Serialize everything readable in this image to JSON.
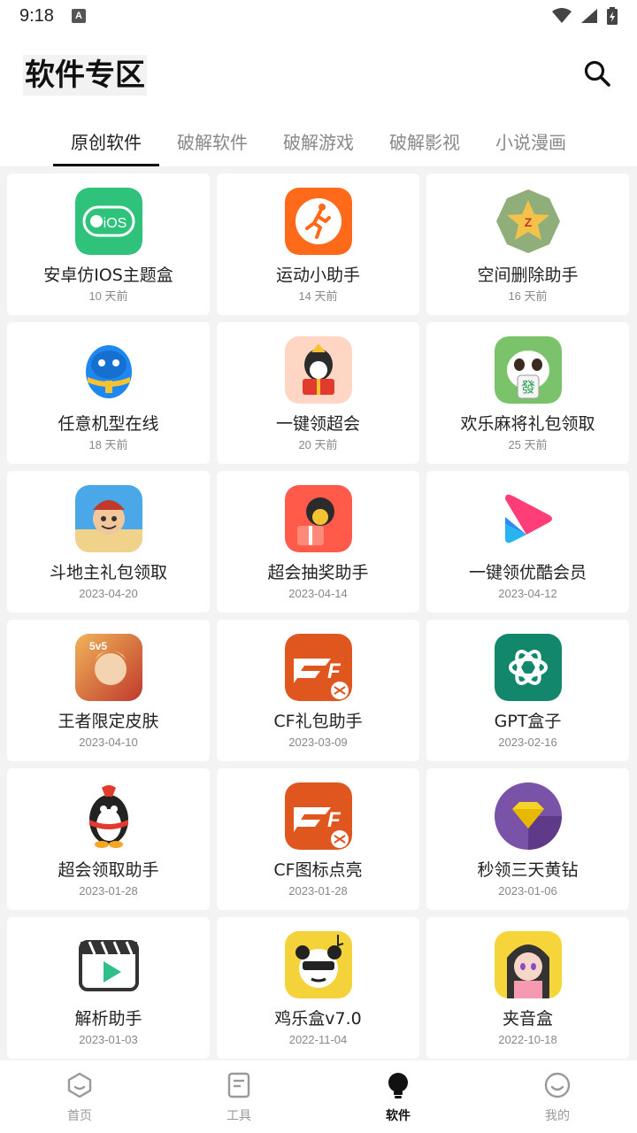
{
  "status_bar": {
    "time": "9:18",
    "notification": "A"
  },
  "header": {
    "title": "软件专区"
  },
  "tabs": [
    {
      "label": "原创软件",
      "active": true
    },
    {
      "label": "破解软件",
      "active": false
    },
    {
      "label": "破解游戏",
      "active": false
    },
    {
      "label": "破解影视",
      "active": false
    },
    {
      "label": "小说漫画",
      "active": false
    }
  ],
  "apps": [
    {
      "name": "安卓仿IOS主题盒",
      "date": "10 天前",
      "icon": "ios-theme-icon",
      "icon_text": "iOS",
      "color": "#2fc27a"
    },
    {
      "name": "运动小助手",
      "date": "14 天前",
      "icon": "running-icon",
      "color": "#ff6a1a"
    },
    {
      "name": "空间删除助手",
      "date": "16 天前",
      "icon": "qzone-star-icon",
      "color": "#8fae7a"
    },
    {
      "name": "任意机型在线",
      "date": "18 天前",
      "icon": "qq-penguin-blue-icon",
      "color": "#1e88f0"
    },
    {
      "name": "一键领超会",
      "date": "20 天前",
      "icon": "qq-gift-icon",
      "color": "#ffd6c4"
    },
    {
      "name": "欢乐麻将礼包领取",
      "date": "25 天前",
      "icon": "mahjong-panda-icon",
      "icon_text": "發",
      "color": "#7ac36a"
    },
    {
      "name": "斗地主礼包领取",
      "date": "2023-04-20",
      "icon": "landlord-game-icon",
      "color": "#4aa8e8"
    },
    {
      "name": "超会抽奖助手",
      "date": "2023-04-14",
      "icon": "lottery-gift-icon",
      "color": "#ff5a4a"
    },
    {
      "name": "一键领优酷会员",
      "date": "2023-04-12",
      "icon": "youku-play-icon",
      "color": "#ff3d77"
    },
    {
      "name": "王者限定皮肤",
      "date": "2023-04-10",
      "icon": "honor-of-kings-icon",
      "icon_text": "5v5",
      "color": "#c0392b"
    },
    {
      "name": "CF礼包助手",
      "date": "2023-03-09",
      "icon": "crossfire-icon",
      "icon_text": "CF",
      "color": "#e0561f"
    },
    {
      "name": "GPT盒子",
      "date": "2023-02-16",
      "icon": "openai-icon",
      "color": "#13876b"
    },
    {
      "name": "超会领取助手",
      "date": "2023-01-28",
      "icon": "qq-penguin-red-icon",
      "color": "#e23b2e"
    },
    {
      "name": "CF图标点亮",
      "date": "2023-01-28",
      "icon": "crossfire-icon",
      "icon_text": "CF",
      "color": "#e0561f"
    },
    {
      "name": "秒领三天黄钻",
      "date": "2023-01-06",
      "icon": "yellow-diamond-icon",
      "color": "#7a52a8"
    },
    {
      "name": "解析助手",
      "date": "2023-01-03",
      "icon": "video-clapper-icon",
      "color": "#2fbf8a"
    },
    {
      "name": "鸡乐盒v7.0",
      "date": "2022-11-04",
      "icon": "panda-meme-icon",
      "color": "#f3d23a"
    },
    {
      "name": "夹音盒",
      "date": "2022-10-18",
      "icon": "anime-girl-icon",
      "color": "#f5d53a"
    }
  ],
  "bottom_nav": [
    {
      "label": "首页",
      "icon": "home-icon",
      "active": false
    },
    {
      "label": "工具",
      "icon": "tools-icon",
      "active": false
    },
    {
      "label": "软件",
      "icon": "bulb-icon",
      "active": true
    },
    {
      "label": "我的",
      "icon": "smile-icon",
      "active": false
    }
  ]
}
